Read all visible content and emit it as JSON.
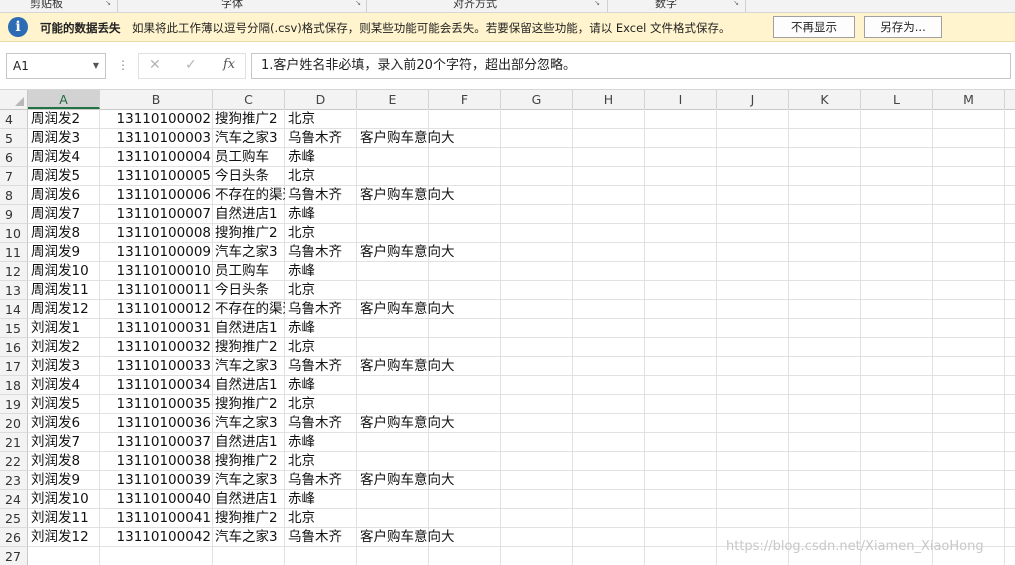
{
  "ribbon": {
    "groups": [
      {
        "label": "剪贴板"
      },
      {
        "label": "字体"
      },
      {
        "label": "对齐方式"
      },
      {
        "label": "数字"
      }
    ]
  },
  "message_bar": {
    "title": "可能的数据丢失",
    "text": "如果将此工作薄以逗号分隔(.csv)格式保存，则某些功能可能会丢失。若要保留这些功能，请以 Excel 文件格式保存。",
    "dont_show_label": "不再显示",
    "save_as_label": "另存为..."
  },
  "formula_bar": {
    "name_box": "A1",
    "formula": "1.客户姓名非必填，录入前20个字符，超出部分忽略。"
  },
  "grid": {
    "columns": [
      "A",
      "B",
      "C",
      "D",
      "E",
      "F",
      "G",
      "H",
      "I",
      "J",
      "K",
      "L",
      "M"
    ],
    "selected_column": "A",
    "rows": [
      {
        "n": "4",
        "a": "周润发2",
        "b": "13110100002",
        "c": "搜狗推广2",
        "d": "北京",
        "e": ""
      },
      {
        "n": "5",
        "a": "周润发3",
        "b": "13110100003",
        "c": "汽车之家3",
        "d": "乌鲁木齐",
        "e": "客户购车意向大"
      },
      {
        "n": "6",
        "a": "周润发4",
        "b": "13110100004",
        "c": "员工购车",
        "d": "赤峰",
        "e": ""
      },
      {
        "n": "7",
        "a": "周润发5",
        "b": "13110100005",
        "c": "今日头条",
        "d": "北京",
        "e": ""
      },
      {
        "n": "8",
        "a": "周润发6",
        "b": "13110100006",
        "c": "不存在的渠道",
        "d": "乌鲁木齐",
        "e": "客户购车意向大"
      },
      {
        "n": "9",
        "a": "周润发7",
        "b": "13110100007",
        "c": "自然进店1",
        "d": "赤峰",
        "e": ""
      },
      {
        "n": "10",
        "a": "周润发8",
        "b": "13110100008",
        "c": "搜狗推广2",
        "d": "北京",
        "e": ""
      },
      {
        "n": "11",
        "a": "周润发9",
        "b": "13110100009",
        "c": "汽车之家3",
        "d": "乌鲁木齐",
        "e": "客户购车意向大"
      },
      {
        "n": "12",
        "a": "周润发10",
        "b": "13110100010",
        "c": "员工购车",
        "d": "赤峰",
        "e": ""
      },
      {
        "n": "13",
        "a": "周润发11",
        "b": "13110100011",
        "c": "今日头条",
        "d": "北京",
        "e": ""
      },
      {
        "n": "14",
        "a": "周润发12",
        "b": "13110100012",
        "c": "不存在的渠道",
        "d": "乌鲁木齐",
        "e": "客户购车意向大"
      },
      {
        "n": "15",
        "a": "刘润发1",
        "b": "13110100031",
        "c": "自然进店1",
        "d": "赤峰",
        "e": ""
      },
      {
        "n": "16",
        "a": "刘润发2",
        "b": "13110100032",
        "c": "搜狗推广2",
        "d": "北京",
        "e": ""
      },
      {
        "n": "17",
        "a": "刘润发3",
        "b": "13110100033",
        "c": "汽车之家3",
        "d": "乌鲁木齐",
        "e": "客户购车意向大"
      },
      {
        "n": "18",
        "a": "刘润发4",
        "b": "13110100034",
        "c": "自然进店1",
        "d": "赤峰",
        "e": ""
      },
      {
        "n": "19",
        "a": "刘润发5",
        "b": "13110100035",
        "c": "搜狗推广2",
        "d": "北京",
        "e": ""
      },
      {
        "n": "20",
        "a": "刘润发6",
        "b": "13110100036",
        "c": "汽车之家3",
        "d": "乌鲁木齐",
        "e": "客户购车意向大"
      },
      {
        "n": "21",
        "a": "刘润发7",
        "b": "13110100037",
        "c": "自然进店1",
        "d": "赤峰",
        "e": ""
      },
      {
        "n": "22",
        "a": "刘润发8",
        "b": "13110100038",
        "c": "搜狗推广2",
        "d": "北京",
        "e": ""
      },
      {
        "n": "23",
        "a": "刘润发9",
        "b": "13110100039",
        "c": "汽车之家3",
        "d": "乌鲁木齐",
        "e": "客户购车意向大"
      },
      {
        "n": "24",
        "a": "刘润发10",
        "b": "13110100040",
        "c": "自然进店1",
        "d": "赤峰",
        "e": ""
      },
      {
        "n": "25",
        "a": "刘润发11",
        "b": "13110100041",
        "c": "搜狗推广2",
        "d": "北京",
        "e": ""
      },
      {
        "n": "26",
        "a": "刘润发12",
        "b": "13110100042",
        "c": "汽车之家3",
        "d": "乌鲁木齐",
        "e": "客户购车意向大"
      },
      {
        "n": "27",
        "a": "",
        "b": "",
        "c": "",
        "d": "",
        "e": ""
      }
    ]
  },
  "watermark": "https://blog.csdn.net/Xiamen_XiaoHong"
}
